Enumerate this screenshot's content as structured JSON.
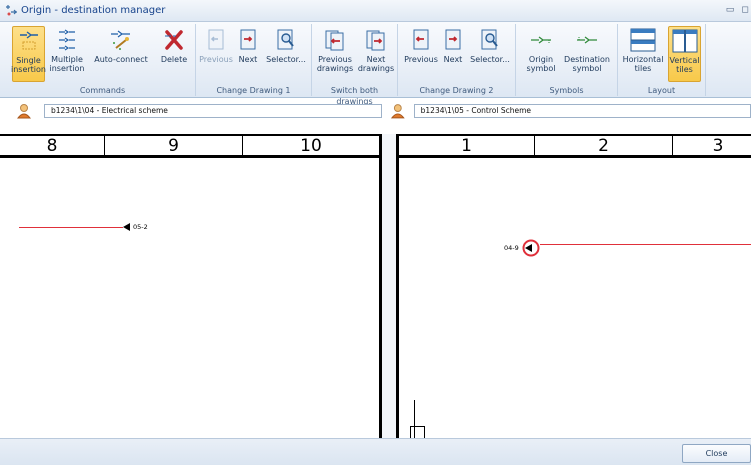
{
  "window": {
    "title": "Origin - destination manager"
  },
  "ribbon": {
    "commands": {
      "label": "Commands",
      "single_insertion": "Single\ninsertion",
      "multiple_insertion": "Multiple\ninsertion",
      "auto_connect": "Auto-connect",
      "delete": "Delete"
    },
    "change1": {
      "label": "Change Drawing 1",
      "previous": "Previous",
      "next": "Next",
      "selector": "Selector..."
    },
    "switch": {
      "label": "Switch both drawings",
      "previous": "Previous\ndrawings",
      "next": "Next\ndrawings"
    },
    "change2": {
      "label": "Change Drawing 2",
      "previous": "Previous",
      "next": "Next",
      "selector": "Selector..."
    },
    "symbols": {
      "label": "Symbols",
      "origin": "Origin\nsymbol",
      "destination": "Destination\nsymbol"
    },
    "layout": {
      "label": "Layout",
      "horizontal": "Horizontal\ntiles",
      "vertical": "Vertical\ntiles"
    }
  },
  "drawing1": {
    "path": "b1234\\1\\04 - Electrical scheme",
    "columns": [
      "8",
      "9",
      "10"
    ],
    "arrow_label": "05-2"
  },
  "drawing2": {
    "path": "b1234\\1\\05 - Control Scheme",
    "columns": [
      "1",
      "2",
      "3"
    ],
    "arrow_label": "04-9"
  },
  "footer": {
    "close": "Close"
  },
  "colors": {
    "accent_active": "#f8c94a",
    "wire": "#e0303a"
  }
}
